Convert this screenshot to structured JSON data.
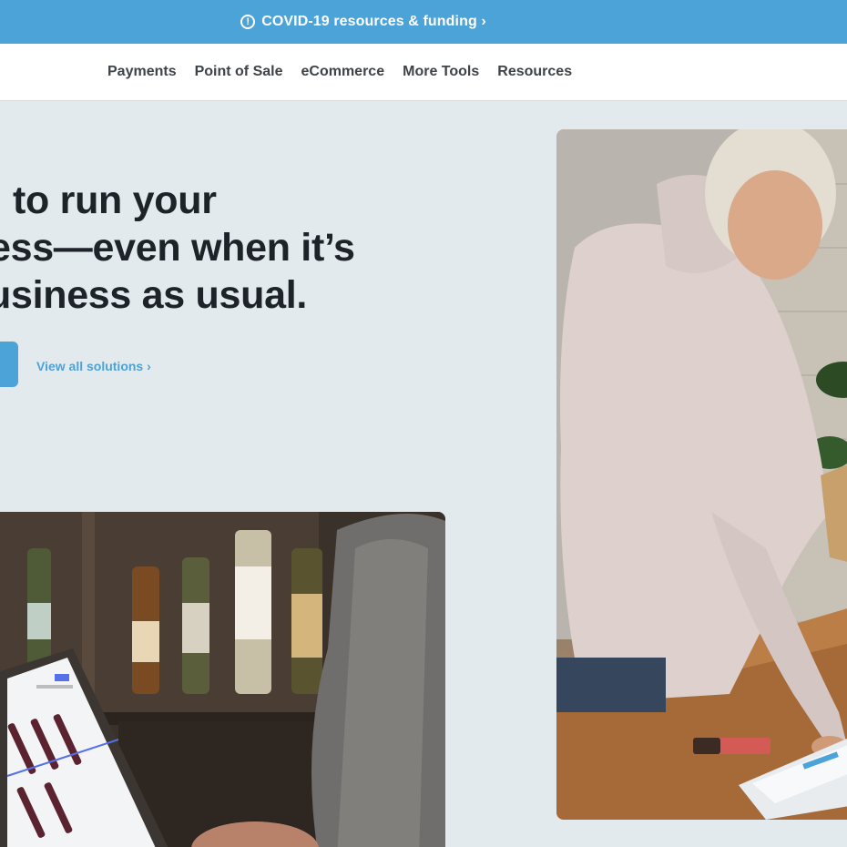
{
  "banner": {
    "icon": "info-circle-icon",
    "text": "COVID-19 resources & funding ›",
    "background": "#4ba3d8"
  },
  "nav": {
    "items": [
      {
        "label": "Payments"
      },
      {
        "label": "Point of Sale"
      },
      {
        "label": "eCommerce"
      },
      {
        "label": "More Tools"
      },
      {
        "label": "Resources"
      }
    ]
  },
  "hero": {
    "headline_lines": [
      " to run your",
      "ness—even when it’s",
      "usiness as usual."
    ],
    "view_all_link": "View all solutions ›",
    "accent": "#4ba3d8"
  },
  "images": {
    "right": "woman-at-counter-with-tablet-photo",
    "left": "laptop-with-wine-shop-photo"
  }
}
